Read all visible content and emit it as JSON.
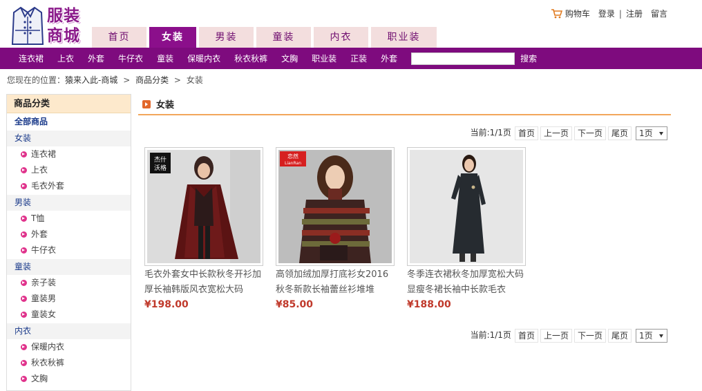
{
  "logo": {
    "line1": "服装",
    "line2": "商城"
  },
  "tabs": [
    "首页",
    "女装",
    "男装",
    "童装",
    "内衣",
    "职业装"
  ],
  "top_links": {
    "cart": "购物车",
    "login": "登录",
    "sep": "|",
    "register": "注册",
    "message": "留言"
  },
  "nav_items": [
    "连衣裙",
    "上衣",
    "外套",
    "牛仔衣",
    "童装",
    "保暖内衣",
    "秋衣秋裤",
    "文胸",
    "职业装",
    "正装",
    "外套"
  ],
  "search": {
    "value": "",
    "button": "搜索"
  },
  "breadcrumb": {
    "prefix": "您现在的位置：",
    "home": "猿来入此-商城",
    "sep": ">",
    "category": "商品分类",
    "current": "女装"
  },
  "sidebar": {
    "title": "商品分类",
    "all": "全部商品",
    "groups": [
      {
        "name": "女装",
        "items": [
          "连衣裙",
          "上衣",
          "毛衣外套"
        ]
      },
      {
        "name": "男装",
        "items": [
          "T恤",
          "外套",
          "牛仔衣"
        ]
      },
      {
        "name": "童装",
        "items": [
          "亲子装",
          "童装男",
          "童装女"
        ]
      },
      {
        "name": "内衣",
        "items": [
          "保暖内衣",
          "秋衣秋裤",
          "文胸"
        ]
      }
    ]
  },
  "main": {
    "title": "女装"
  },
  "pager": {
    "current": "当前:1/1页",
    "first": "首页",
    "prev": "上一页",
    "next": "下一页",
    "last": "尾页",
    "select": "1页"
  },
  "products": [
    {
      "name": "毛衣外套女中长款秋冬开衫加厚长袖韩版风衣宽松大码",
      "price": "¥198.00",
      "badge": "杰什沃格"
    },
    {
      "name": "高领加绒加厚打底衫女2016秋冬新款长袖蕾丝衫堆堆",
      "price": "¥85.00",
      "badge": "恋然 LianRan"
    },
    {
      "name": "冬季连衣裙秋冬加厚宽松大码显瘦冬裙长袖中长款毛衣",
      "price": "¥188.00",
      "badge": ""
    }
  ],
  "colors": {
    "brand": "#7e0b7e",
    "tab_bg": "#f3dede",
    "price": "#c0392b",
    "accent": "#f2a65a"
  }
}
